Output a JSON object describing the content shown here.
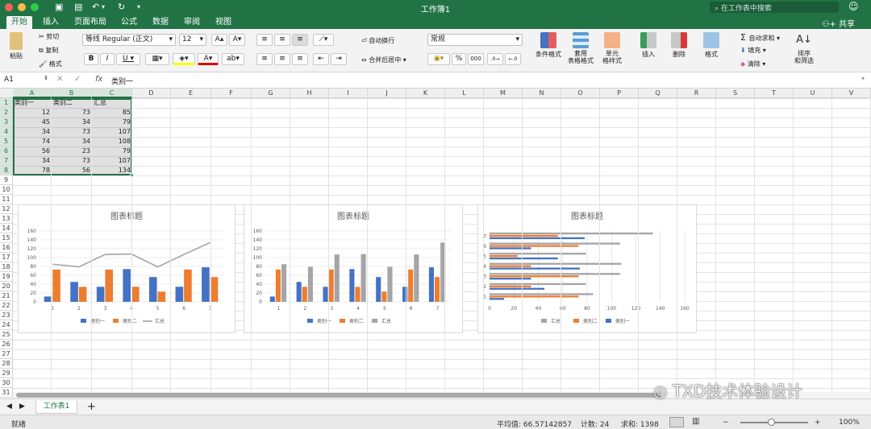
{
  "window": {
    "title": "工作簿1",
    "search_placeholder": "在工作表中搜索"
  },
  "colors": {
    "accent": "#217346",
    "series1": "#4472c4",
    "series2": "#ed7d31",
    "series3": "#a5a5a5"
  },
  "ribbon_tabs": [
    {
      "label": "开始",
      "active": true
    },
    {
      "label": "插入"
    },
    {
      "label": "页面布局"
    },
    {
      "label": "公式"
    },
    {
      "label": "数据"
    },
    {
      "label": "审阅"
    },
    {
      "label": "视图"
    }
  ],
  "share_label": "共享",
  "ribbon": {
    "paste": "粘贴",
    "cut": "剪切",
    "copy": "复制",
    "format_painter": "格式",
    "font_name": "等线 Regular (正文)",
    "font_size": "12",
    "wrap_text": "自动换行",
    "merge_center": "合并后居中",
    "number_format": "常规",
    "percent": "%",
    "thousands": "000",
    "cond_format": "条件格式",
    "table_format_1": "套用",
    "table_format_2": "表格格式",
    "cell_style_1": "单元",
    "cell_style_2": "格样式",
    "insert": "插入",
    "delete": "删除",
    "format": "格式",
    "autosum": "自动求和",
    "fill": "填充",
    "clear": "清除",
    "sort_1": "排序",
    "sort_2": "和筛选"
  },
  "formula_bar": {
    "cell_ref": "A1",
    "fx": "fx",
    "value": "类别一"
  },
  "columns": [
    "A",
    "B",
    "C",
    "D",
    "E",
    "F",
    "G",
    "H",
    "I",
    "J",
    "K",
    "L",
    "M",
    "N",
    "O",
    "P",
    "Q",
    "R",
    "S",
    "T",
    "U",
    "V"
  ],
  "rows": [
    "1",
    "2",
    "3",
    "4",
    "5",
    "6",
    "7",
    "8",
    "9",
    "10",
    "11",
    "12",
    "13",
    "14",
    "15",
    "16",
    "17",
    "18",
    "19",
    "20",
    "21",
    "22",
    "23",
    "24",
    "25",
    "26",
    "27",
    "28",
    "29",
    "30",
    "31"
  ],
  "table": {
    "headers": [
      "类别一",
      "类别二",
      "汇总"
    ],
    "rows": [
      [
        "12",
        "73",
        "85"
      ],
      [
        "45",
        "34",
        "79"
      ],
      [
        "34",
        "73",
        "107"
      ],
      [
        "74",
        "34",
        "108"
      ],
      [
        "56",
        "23",
        "79"
      ],
      [
        "34",
        "73",
        "107"
      ],
      [
        "78",
        "56",
        "134"
      ]
    ]
  },
  "chart_data": [
    {
      "type": "bar",
      "title": "图表标题",
      "categories": [
        "1",
        "2",
        "3",
        "4",
        "5",
        "6",
        "7"
      ],
      "ylim": [
        0,
        160
      ],
      "yticks": [
        "0",
        "20",
        "40",
        "60",
        "80",
        "100",
        "120",
        "140",
        "160"
      ],
      "series": [
        {
          "name": "类别一",
          "kind": "bar",
          "values": [
            12,
            45,
            34,
            74,
            56,
            34,
            78
          ]
        },
        {
          "name": "类别二",
          "kind": "bar",
          "values": [
            73,
            34,
            73,
            34,
            23,
            73,
            56
          ]
        },
        {
          "name": "汇总",
          "kind": "line",
          "values": [
            85,
            79,
            107,
            108,
            79,
            107,
            134
          ]
        }
      ],
      "legend": "bottom",
      "grid": true
    },
    {
      "type": "bar",
      "title": "图表标题",
      "categories": [
        "1",
        "2",
        "3",
        "4",
        "5",
        "6",
        "7"
      ],
      "ylim": [
        0,
        160
      ],
      "yticks": [
        "0",
        "20",
        "40",
        "60",
        "80",
        "100",
        "120",
        "140",
        "160"
      ],
      "series": [
        {
          "name": "类别一",
          "values": [
            12,
            45,
            34,
            74,
            56,
            34,
            78
          ]
        },
        {
          "name": "类别二",
          "values": [
            73,
            34,
            73,
            34,
            23,
            73,
            56
          ]
        },
        {
          "name": "汇总",
          "values": [
            85,
            79,
            107,
            108,
            79,
            107,
            134
          ]
        }
      ],
      "legend": "bottom",
      "grid": true
    },
    {
      "type": "bar",
      "orientation": "horizontal",
      "title": "图表标题",
      "categories": [
        "1",
        "2",
        "3",
        "4",
        "5",
        "6",
        "7"
      ],
      "xlim": [
        0,
        160
      ],
      "xticks": [
        "0",
        "20",
        "40",
        "60",
        "80",
        "100",
        "120",
        "140",
        "160"
      ],
      "series": [
        {
          "name": "类别一",
          "values": [
            12,
            45,
            34,
            74,
            56,
            34,
            78
          ]
        },
        {
          "name": "类别二",
          "values": [
            73,
            34,
            73,
            34,
            23,
            73,
            56
          ]
        },
        {
          "name": "汇总",
          "values": [
            85,
            79,
            107,
            108,
            79,
            107,
            134
          ]
        }
      ],
      "legend": "bottom",
      "legend_order": [
        "汇总",
        "类别二",
        "类别一"
      ],
      "grid": true
    }
  ],
  "sheet_tab": "工作表1",
  "status": {
    "ready": "就绪",
    "average": "平均值: 66.57142857",
    "count": "计数: 24",
    "sum": "求和: 1398",
    "zoom": "100%"
  },
  "watermark": "TXD技术体验设计"
}
